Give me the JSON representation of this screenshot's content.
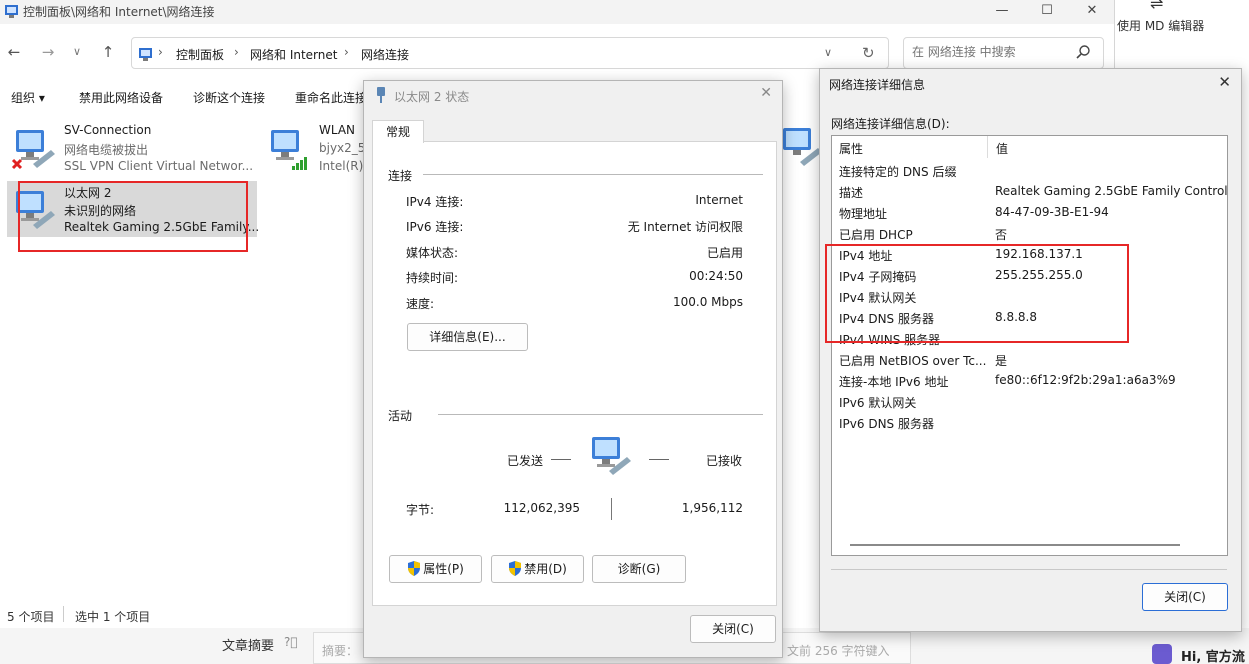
{
  "explorer": {
    "title": "控制面板\\网络和 Internet\\网络连接",
    "address": [
      "控制面板",
      "网络和 Internet",
      "网络连接"
    ],
    "search_placeholder": "在 网络连接 中搜索",
    "commands": [
      "组织 ▾",
      "禁用此网络设备",
      "诊断这个连接",
      "重命名此连接"
    ],
    "items": [
      {
        "name": "SV-Connection",
        "line2": "网络电缆被拔出",
        "line3": "SSL VPN Client Virtual Networ..."
      },
      {
        "name": "WLAN",
        "line2": "bjyx2_5G",
        "line3": "Intel(R)"
      },
      {
        "name": "以太网 2",
        "line2": "未识别的网络",
        "line3": "Realtek Gaming 2.5GbE Family..."
      }
    ],
    "status_count": "5 个项目",
    "status_selected": "选中 1 个项目"
  },
  "background": {
    "editor_label": "使用 MD 编辑器",
    "summary_label": "文章摘要",
    "summary_placeholder": "摘要：",
    "summary_hint": "文前 256 字符键入",
    "greeting": "Hi, 官方",
    "greeting_hidden": "流"
  },
  "status_dialog": {
    "title": "以太网 2 状态",
    "tab": "常规",
    "connection_group": "连接",
    "fields": [
      {
        "label": "IPv4 连接:",
        "value": "Internet"
      },
      {
        "label": "IPv6 连接:",
        "value": "无 Internet 访问权限"
      },
      {
        "label": "媒体状态:",
        "value": "已启用"
      },
      {
        "label": "持续时间:",
        "value": "00:24:50"
      },
      {
        "label": "速度:",
        "value": "100.0 Mbps"
      }
    ],
    "details_button": "详细信息(E)...",
    "activity_group": "活动",
    "sent_label": "已发送",
    "received_label": "已接收",
    "bytes_label": "字节:",
    "bytes_sent": "112,062,395",
    "bytes_received": "1,956,112",
    "properties_button": "属性(P)",
    "disable_button": "禁用(D)",
    "diagnose_button": "诊断(G)",
    "close_button": "关闭(C)"
  },
  "details_dialog": {
    "title": "网络连接详细信息",
    "header": "网络连接详细信息(D):",
    "col_property": "属性",
    "col_value": "值",
    "rows": [
      {
        "p": "连接特定的 DNS 后缀",
        "v": ""
      },
      {
        "p": "描述",
        "v": "Realtek Gaming 2.5GbE Family Controller"
      },
      {
        "p": "物理地址",
        "v": "84-47-09-3B-E1-94"
      },
      {
        "p": "已启用 DHCP",
        "v": "否"
      },
      {
        "p": "IPv4 地址",
        "v": "192.168.137.1"
      },
      {
        "p": "IPv4 子网掩码",
        "v": "255.255.255.0"
      },
      {
        "p": "IPv4 默认网关",
        "v": ""
      },
      {
        "p": "IPv4 DNS 服务器",
        "v": "8.8.8.8"
      },
      {
        "p": "IPv4 WINS 服务器",
        "v": ""
      },
      {
        "p": "已启用 NetBIOS over Tc...",
        "v": "是"
      },
      {
        "p": "连接-本地 IPv6 地址",
        "v": "fe80::6f12:9f2b:29a1:a6a3%9"
      },
      {
        "p": "IPv6 默认网关",
        "v": ""
      },
      {
        "p": "IPv6 DNS 服务器",
        "v": ""
      }
    ],
    "close_button": "关闭(C)"
  },
  "colors": {
    "highlight_box": "#e62727",
    "selected_item": "#d9d9d9",
    "dialog_bg": "#f0f0f0"
  }
}
